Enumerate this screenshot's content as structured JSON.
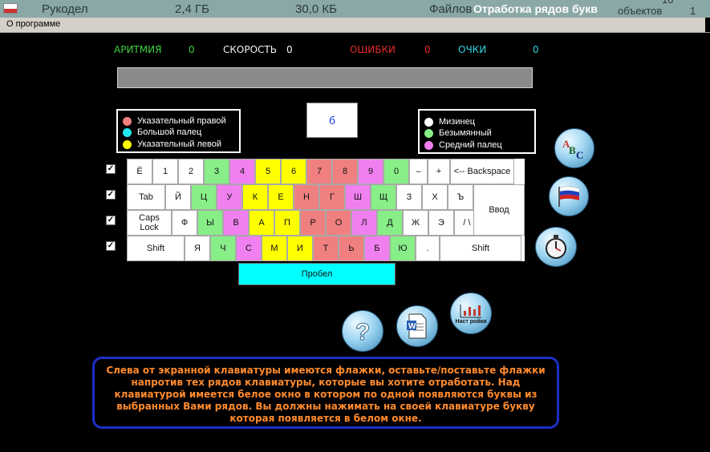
{
  "window": {
    "title": "Отработка рядов букв",
    "background_text": [
      "Рукодел",
      "2,4 ГБ",
      "30,0 КБ",
      "Файлов",
      "10",
      "объектов",
      "1"
    ]
  },
  "menu": {
    "about": "О программе"
  },
  "stats": [
    {
      "label": "АРИТМИЯ",
      "value": "0",
      "color": "#3fd13f",
      "value_color": "#3fd13f"
    },
    {
      "label": "СКОРОСТЬ",
      "value": "0",
      "color": "#f2f2f2",
      "value_color": "#f2f2f2"
    },
    {
      "label": "ОШИБКИ",
      "value": "0",
      "color": "#e22a2a",
      "value_color": "#e22a2a"
    },
    {
      "label": "ОЧКИ",
      "value": "0",
      "color": "#2fd5e0",
      "value_color": "#2fd5e0"
    }
  ],
  "progress": {
    "fraction": 0
  },
  "legend_left": [
    {
      "label": "Указательный правой",
      "color": "#f08080"
    },
    {
      "label": "Большой палец",
      "color": "#22e8f0"
    },
    {
      "label": "Указательный левой",
      "color": "#ffff00"
    }
  ],
  "legend_right": [
    {
      "label": "Мизинец",
      "color": "#ffffff"
    },
    {
      "label": "Безымянный",
      "color": "#88ee88"
    },
    {
      "label": "Средний палец",
      "color": "#f080f0"
    }
  ],
  "current_letter": "б",
  "row_checkboxes": [
    true,
    true,
    true,
    true
  ],
  "keyboard": {
    "rows": [
      [
        {
          "label": "Ё",
          "color": "#ffffff"
        },
        {
          "label": "1",
          "color": "#ffffff"
        },
        {
          "label": "2",
          "color": "#ffffff"
        },
        {
          "label": "3",
          "color": "#88ee88"
        },
        {
          "label": "4",
          "color": "#f080f0"
        },
        {
          "label": "5",
          "color": "#ffff00"
        },
        {
          "label": "6",
          "color": "#ffff00"
        },
        {
          "label": "7",
          "color": "#f08080"
        },
        {
          "label": "8",
          "color": "#f08080"
        },
        {
          "label": "9",
          "color": "#f080f0"
        },
        {
          "label": "0",
          "color": "#88ee88"
        },
        {
          "label": "–",
          "color": "#ffffff"
        },
        {
          "label": "+",
          "color": "#ffffff"
        },
        {
          "label": "<-- Backspace",
          "color": "#ffffff"
        }
      ],
      [
        {
          "label": "Tab",
          "color": "#ffffff"
        },
        {
          "label": "Й",
          "color": "#ffffff"
        },
        {
          "label": "Ц",
          "color": "#88ee88"
        },
        {
          "label": "У",
          "color": "#f080f0"
        },
        {
          "label": "К",
          "color": "#ffff00"
        },
        {
          "label": "Е",
          "color": "#ffff00"
        },
        {
          "label": "Н",
          "color": "#f08080"
        },
        {
          "label": "Г",
          "color": "#f08080"
        },
        {
          "label": "Ш",
          "color": "#f080f0"
        },
        {
          "label": "Щ",
          "color": "#88ee88"
        },
        {
          "label": "З",
          "color": "#ffffff"
        },
        {
          "label": "Х",
          "color": "#ffffff"
        },
        {
          "label": "Ъ",
          "color": "#ffffff"
        }
      ],
      [
        {
          "label": "Caps Lock",
          "color": "#ffffff"
        },
        {
          "label": "Ф",
          "color": "#ffffff"
        },
        {
          "label": "Ы",
          "color": "#88ee88"
        },
        {
          "label": "В",
          "color": "#f080f0"
        },
        {
          "label": "А",
          "color": "#ffff00"
        },
        {
          "label": "П",
          "color": "#ffff00"
        },
        {
          "label": "Р",
          "color": "#f08080"
        },
        {
          "label": "О",
          "color": "#f08080"
        },
        {
          "label": "Л",
          "color": "#f080f0"
        },
        {
          "label": "Д",
          "color": "#88ee88"
        },
        {
          "label": "Ж",
          "color": "#ffffff"
        },
        {
          "label": "Э",
          "color": "#ffffff"
        },
        {
          "label": "/ \\",
          "color": "#ffffff"
        },
        {
          "label": "Ввод",
          "color": "#ffffff"
        }
      ],
      [
        {
          "label": "Shift",
          "color": "#ffffff"
        },
        {
          "label": "Я",
          "color": "#ffffff"
        },
        {
          "label": "Ч",
          "color": "#88ee88"
        },
        {
          "label": "С",
          "color": "#f080f0"
        },
        {
          "label": "М",
          "color": "#ffff00"
        },
        {
          "label": "И",
          "color": "#ffff00"
        },
        {
          "label": "Т",
          "color": "#f08080"
        },
        {
          "label": "Ь",
          "color": "#f08080"
        },
        {
          "label": "Б",
          "color": "#f080f0"
        },
        {
          "label": "Ю",
          "color": "#88ee88"
        },
        {
          "label": ".",
          "color": "#ffffff"
        },
        {
          "label": "Shift",
          "color": "#ffffff"
        }
      ]
    ],
    "space_label": "Пробел",
    "space_color": "#00ffff"
  },
  "icons": {
    "abc": "abc-spelling-icon",
    "flag": "russian-flag-icon",
    "timer": "stopwatch-icon",
    "help": "question-mark-icon",
    "doc": "word-document-icon",
    "settings": "settings-chart-icon",
    "settings_caption": "Наст ройки"
  },
  "help_text": "Слева от экранной клавиатуры имеются флажки, оставьте/поставьте флажки напротив тех рядов клавиатуры, которые вы хотите отработать.   Над клавиатурой имеется белое окно в котором по одной появляются буквы из выбранных Вами рядов. Вы должны нажимать на своей клавиатуре букву которая появляется в белом окне."
}
